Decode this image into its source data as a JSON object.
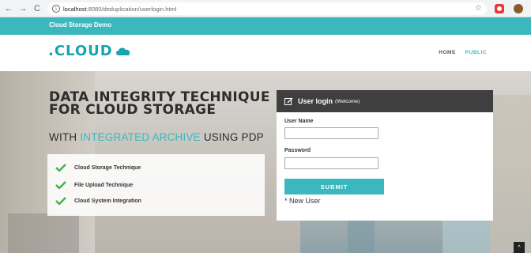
{
  "browser": {
    "url_host": "localhost",
    "url_path": ":8080/deduplication/userlogin.html",
    "icons": {
      "back": "arrow-left-icon",
      "forward": "arrow-right-icon",
      "reload": "reload-icon",
      "info": "info-icon",
      "bookmark": "star-icon"
    }
  },
  "topbar": {
    "brand": "Cloud Storage Demo",
    "color": "#3ab8bd"
  },
  "header": {
    "logo_text": ".CLOUD",
    "nav": [
      {
        "label": "HOME",
        "active": false
      },
      {
        "label": "PUBLIC",
        "active": true
      }
    ]
  },
  "hero": {
    "title": "DATA INTEGRITY TECHNIQUE FOR CLOUD STORAGE",
    "subtitle_prefix": "WITH ",
    "subtitle_accent": "INTEGRATED ARCHIVE",
    "subtitle_suffix": " USING PDP",
    "features": [
      "Cloud Storage Technique",
      "File Upload Technique",
      "Cloud System Integration"
    ]
  },
  "login": {
    "title": "User login",
    "subtitle": "(Welcome)",
    "username_label": "User Name",
    "username_value": "",
    "password_label": "Password",
    "password_value": "",
    "submit_label": "SUBMIT",
    "new_user": "* New User"
  },
  "scroll_top_icon": "chevron-up-icon"
}
